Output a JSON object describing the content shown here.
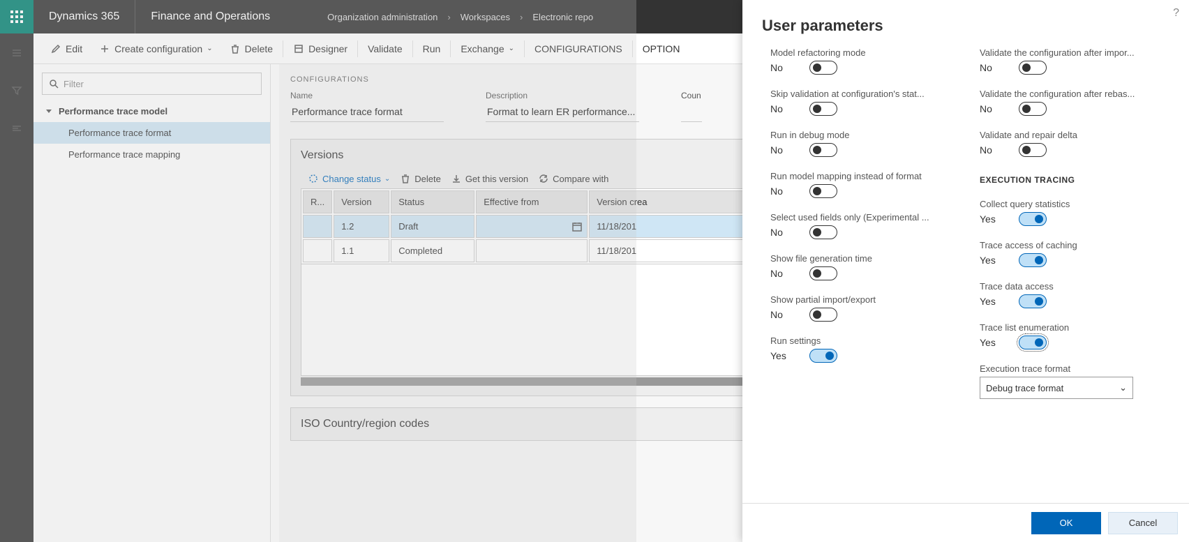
{
  "topbar": {
    "brand": "Dynamics 365",
    "module": "Finance and Operations",
    "breadcrumb": [
      "Organization administration",
      "Workspaces",
      "Electronic repo"
    ]
  },
  "actionbar": {
    "edit": "Edit",
    "create": "Create configuration",
    "delete": "Delete",
    "designer": "Designer",
    "validate": "Validate",
    "run": "Run",
    "exchange": "Exchange",
    "configurations": "CONFIGURATIONS",
    "options": "OPTION"
  },
  "filter": {
    "placeholder": "Filter"
  },
  "tree": {
    "root": "Performance trace model",
    "children": [
      "Performance trace format",
      "Performance trace mapping"
    ]
  },
  "details": {
    "section": "CONFIGURATIONS",
    "name_label": "Name",
    "name_value": "Performance trace format",
    "desc_label": "Description",
    "desc_value": "Format to learn ER performance...",
    "country_label": "Coun"
  },
  "versions": {
    "title": "Versions",
    "toolbar": {
      "change_status": "Change status",
      "delete": "Delete",
      "get": "Get this version",
      "compare": "Compare with"
    },
    "columns": {
      "r": "R...",
      "version": "Version",
      "status": "Status",
      "effective": "Effective from",
      "created": "Version crea"
    },
    "rows": [
      {
        "version": "1.2",
        "status": "Draft",
        "effective": "",
        "created": "11/18/201"
      },
      {
        "version": "1.1",
        "status": "Completed",
        "effective": "",
        "created": "11/18/201"
      }
    ]
  },
  "iso_section": "ISO Country/region codes",
  "panel": {
    "title": "User parameters",
    "left": [
      {
        "label": "Model refactoring mode",
        "value": "No",
        "on": false
      },
      {
        "label": "Skip validation at configuration's stat...",
        "value": "No",
        "on": false
      },
      {
        "label": "Run in debug mode",
        "value": "No",
        "on": false
      },
      {
        "label": "Run model mapping instead of format",
        "value": "No",
        "on": false
      },
      {
        "label": "Select used fields only (Experimental ...",
        "value": "No",
        "on": false
      },
      {
        "label": "Show file generation time",
        "value": "No",
        "on": false
      },
      {
        "label": "Show partial import/export",
        "value": "No",
        "on": false
      },
      {
        "label": "Run settings",
        "value": "Yes",
        "on": true
      }
    ],
    "right_top": [
      {
        "label": "Validate the configuration after impor...",
        "value": "No",
        "on": false
      },
      {
        "label": "Validate the configuration after rebas...",
        "value": "No",
        "on": false
      },
      {
        "label": "Validate and repair delta",
        "value": "No",
        "on": false
      }
    ],
    "group_title": "EXECUTION TRACING",
    "right_group": [
      {
        "label": "Collect query statistics",
        "value": "Yes",
        "on": true
      },
      {
        "label": "Trace access of caching",
        "value": "Yes",
        "on": true
      },
      {
        "label": "Trace data access",
        "value": "Yes",
        "on": true
      },
      {
        "label": "Trace list enumeration",
        "value": "Yes",
        "on": true,
        "focus": true
      }
    ],
    "select_label": "Execution trace format",
    "select_value": "Debug trace format",
    "ok": "OK",
    "cancel": "Cancel"
  }
}
